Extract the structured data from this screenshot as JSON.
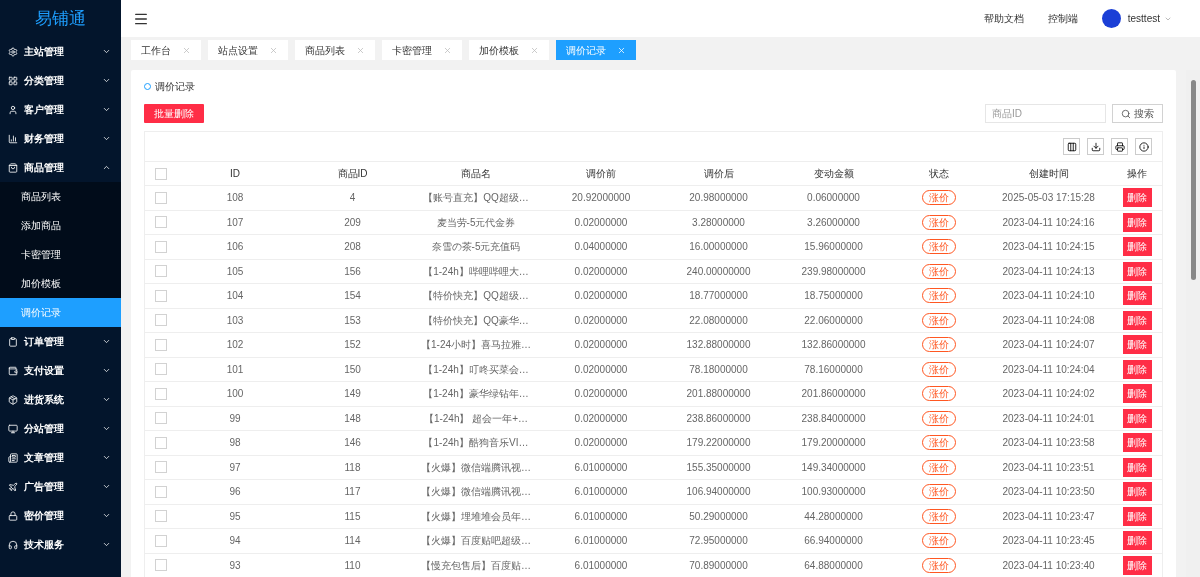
{
  "sidebar": {
    "logo": "易铺通",
    "items": [
      {
        "label": "主站管理",
        "expanded": false
      },
      {
        "label": "分类管理",
        "expanded": false
      },
      {
        "label": "客户管理",
        "expanded": false
      },
      {
        "label": "财务管理",
        "expanded": false
      },
      {
        "label": "商品管理",
        "expanded": true,
        "children": [
          {
            "label": "商品列表",
            "selected": false
          },
          {
            "label": "添加商品",
            "selected": false
          },
          {
            "label": "卡密管理",
            "selected": false
          },
          {
            "label": "加价模板",
            "selected": false
          },
          {
            "label": "调价记录",
            "selected": true
          }
        ]
      },
      {
        "label": "订单管理",
        "expanded": false
      },
      {
        "label": "支付设置",
        "expanded": false
      },
      {
        "label": "进货系统",
        "expanded": false
      },
      {
        "label": "分站管理",
        "expanded": false
      },
      {
        "label": "文章管理",
        "expanded": false
      },
      {
        "label": "广告管理",
        "expanded": false
      },
      {
        "label": "密价管理",
        "expanded": false
      },
      {
        "label": "技术服务",
        "expanded": false
      }
    ]
  },
  "header": {
    "links": [
      "帮助文档",
      "控制端"
    ],
    "user": "testtest"
  },
  "tabs": [
    {
      "label": "工作台",
      "selected": false
    },
    {
      "label": "站点设置",
      "selected": false
    },
    {
      "label": "商品列表",
      "selected": false
    },
    {
      "label": "卡密管理",
      "selected": false
    },
    {
      "label": "加价模板",
      "selected": false
    },
    {
      "label": "调价记录",
      "selected": true
    }
  ],
  "panel": {
    "title": "调价记录",
    "batch_delete": "批量删除",
    "search": {
      "placeholder": "商品ID",
      "button": "搜索"
    }
  },
  "table": {
    "all_checked": false,
    "columns": [
      "ID",
      "商品ID",
      "商品名",
      "调价前",
      "调价后",
      "变动金额",
      "状态",
      "创建时间",
      "操作"
    ],
    "rows": [
      {
        "checked": false,
        "cells": [
          "108",
          "4",
          "【账号直充】QQ超级…",
          "20.92000000",
          "20.98000000",
          "0.06000000",
          "涨价",
          "2025-05-03 17:15:28",
          "删除"
        ]
      },
      {
        "checked": false,
        "cells": [
          "107",
          "209",
          "麦当劳-5元代金券",
          "0.02000000",
          "3.28000000",
          "3.26000000",
          "涨价",
          "2023-04-11 10:24:16",
          "删除"
        ]
      },
      {
        "checked": false,
        "cells": [
          "106",
          "208",
          "奈雪の茶-5元充值码",
          "0.04000000",
          "16.00000000",
          "15.96000000",
          "涨价",
          "2023-04-11 10:24:15",
          "删除"
        ]
      },
      {
        "checked": false,
        "cells": [
          "105",
          "156",
          "【1-24h】哔哩哔哩大…",
          "0.02000000",
          "240.00000000",
          "239.98000000",
          "涨价",
          "2023-04-11 10:24:13",
          "删除"
        ]
      },
      {
        "checked": false,
        "cells": [
          "104",
          "154",
          "【特价快充】QQ超级…",
          "0.02000000",
          "18.77000000",
          "18.75000000",
          "涨价",
          "2023-04-11 10:24:10",
          "删除"
        ]
      },
      {
        "checked": false,
        "cells": [
          "103",
          "153",
          "【特价快充】QQ豪华…",
          "0.02000000",
          "22.08000000",
          "22.06000000",
          "涨价",
          "2023-04-11 10:24:08",
          "删除"
        ]
      },
      {
        "checked": false,
        "cells": [
          "102",
          "152",
          "【1-24小时】喜马拉雅…",
          "0.02000000",
          "132.88000000",
          "132.86000000",
          "涨价",
          "2023-04-11 10:24:07",
          "删除"
        ]
      },
      {
        "checked": false,
        "cells": [
          "101",
          "150",
          "【1-24h】叮咚买菜会…",
          "0.02000000",
          "78.18000000",
          "78.16000000",
          "涨价",
          "2023-04-11 10:24:04",
          "删除"
        ]
      },
      {
        "checked": false,
        "cells": [
          "100",
          "149",
          "【1-24h】豪华绿钻年…",
          "0.02000000",
          "201.88000000",
          "201.86000000",
          "涨价",
          "2023-04-11 10:24:02",
          "删除"
        ]
      },
      {
        "checked": false,
        "cells": [
          "99",
          "148",
          "【1-24h】 超会一年+…",
          "0.02000000",
          "238.86000000",
          "238.84000000",
          "涨价",
          "2023-04-11 10:24:01",
          "删除"
        ]
      },
      {
        "checked": false,
        "cells": [
          "98",
          "146",
          "【1-24h】酷狗音乐VI…",
          "0.02000000",
          "179.22000000",
          "179.20000000",
          "涨价",
          "2023-04-11 10:23:58",
          "删除"
        ]
      },
      {
        "checked": false,
        "cells": [
          "97",
          "118",
          "【火爆】微信端腾讯视…",
          "6.01000000",
          "155.35000000",
          "149.34000000",
          "涨价",
          "2023-04-11 10:23:51",
          "删除"
        ]
      },
      {
        "checked": false,
        "cells": [
          "96",
          "117",
          "【火爆】微信端腾讯视…",
          "6.01000000",
          "106.94000000",
          "100.93000000",
          "涨价",
          "2023-04-11 10:23:50",
          "删除"
        ]
      },
      {
        "checked": false,
        "cells": [
          "95",
          "115",
          "【火爆】埋堆堆会员年…",
          "6.01000000",
          "50.29000000",
          "44.28000000",
          "涨价",
          "2023-04-11 10:23:47",
          "删除"
        ]
      },
      {
        "checked": false,
        "cells": [
          "94",
          "114",
          "【火爆】百度贴吧超级…",
          "6.01000000",
          "72.95000000",
          "66.94000000",
          "涨价",
          "2023-04-11 10:23:45",
          "删除"
        ]
      },
      {
        "checked": false,
        "cells": [
          "93",
          "110",
          "【慢充包售后】百度贴…",
          "6.01000000",
          "70.89000000",
          "64.88000000",
          "涨价",
          "2023-04-11 10:23:40",
          "删除"
        ]
      }
    ]
  }
}
